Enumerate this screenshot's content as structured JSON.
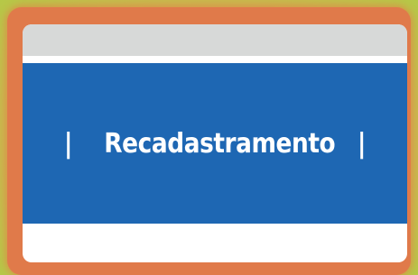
{
  "banner": {
    "title": "Recadastramento",
    "left_separator": "|",
    "right_separator": "|"
  },
  "colors": {
    "background": "#b8c94a",
    "frame": "#e07a4a",
    "banner": "#1e67b3",
    "top_bar": "#d7d9d8",
    "text": "#ffffff"
  }
}
